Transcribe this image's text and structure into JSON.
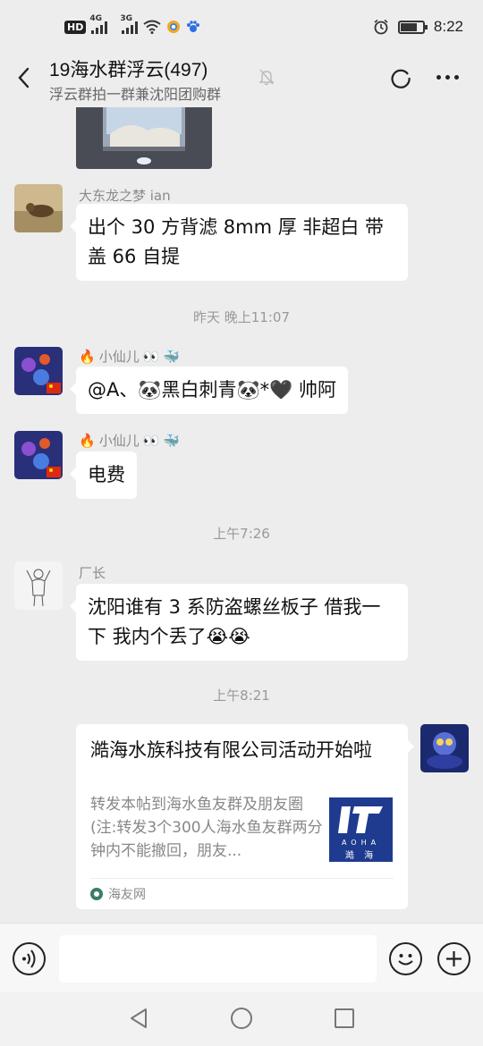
{
  "status_bar": {
    "hd_label": "HD",
    "net1": "4G",
    "net2": "3G",
    "time": "8:22",
    "battery_level": 0.75
  },
  "header": {
    "title": "19海水群浮云(497)",
    "subtitle": "浮云群拍一群兼沈阳团购群",
    "icons": [
      "back-arrow-icon",
      "mute-bell-icon",
      "circle-icon",
      "more-icon"
    ]
  },
  "messages": [
    {
      "type": "image",
      "sender": "",
      "caption": ""
    },
    {
      "type": "text",
      "sender": "大东龙之梦 ian",
      "lines": [
        "出个 30 方背滤 8mm 厚 非超白  带",
        "盖 66 自提"
      ]
    },
    {
      "type": "time",
      "text": "昨天 晚上11:07"
    },
    {
      "type": "text",
      "sender": "小仙儿",
      "text": "@A、🐼黑白刺青🐼*🖤  帅阿"
    },
    {
      "type": "text",
      "sender": "小仙儿",
      "text": "电费"
    },
    {
      "type": "time",
      "text": "上午7:26"
    },
    {
      "type": "text",
      "sender": "厂长",
      "lines": [
        "沈阳谁有 3 系防盗螺丝板子 借我一",
        "下 我内个丢了😭😭"
      ]
    },
    {
      "type": "time",
      "text": "上午8:21"
    }
  ],
  "sender_badges": {
    "fire": "🔥",
    "eyes": "👀",
    "whale": "🐳",
    "flag": "🇨🇳"
  },
  "link_card": {
    "title": "澔海水族科技有限公司活动开始啦",
    "description": "转发本帖到海水鱼友群及朋友圈(注:转发3个300人海水鱼友群两分钟内不能撤回，朋友...",
    "logo_letters": "AOHA",
    "logo_cn": "澔 海",
    "source": "海友网"
  },
  "input_bar": {
    "placeholder": "",
    "icons": [
      "voice-icon",
      "emoji-icon",
      "plus-icon"
    ]
  },
  "nav_bar": {
    "icons": [
      "nav-back-icon",
      "nav-home-icon",
      "nav-recent-icon"
    ]
  }
}
